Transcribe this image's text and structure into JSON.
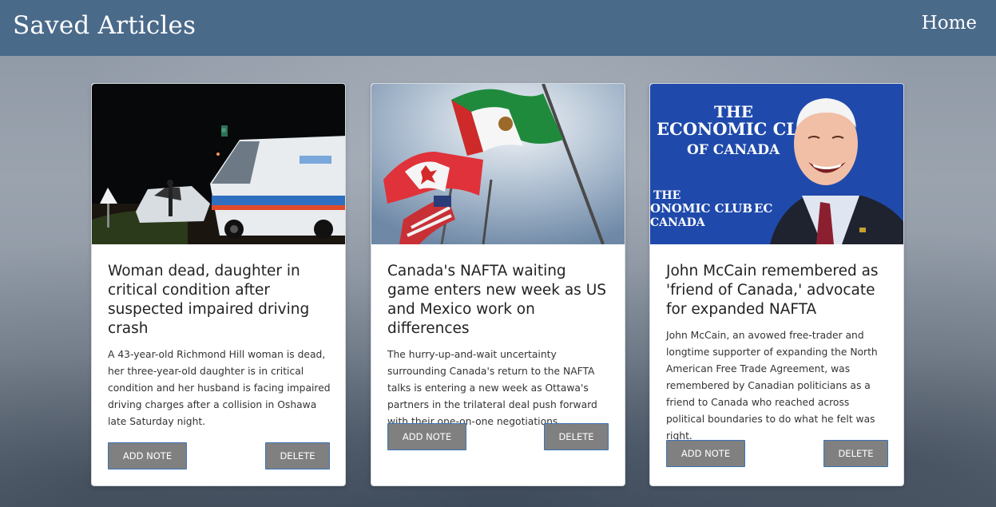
{
  "navbar": {
    "brand": "Saved Articles",
    "home_label": "Home"
  },
  "articles": [
    {
      "image_alt": "Night scene of a crashed white van after collision",
      "title": "Woman dead, daughter in critical condition after suspected impaired driving crash",
      "summary": "A 43-year-old Richmond Hill woman is dead, her three-year-old daughter is in critical condition and her husband is facing impaired driving charges after a collision in Oshawa late Saturday night.",
      "add_note_label": "ADD NOTE",
      "delete_label": "DELETE"
    },
    {
      "image_alt": "Canadian, Mexican and US flags on poles",
      "title": "Canada's NAFTA waiting game enters new week as US and Mexico work on differences",
      "summary": "The hurry-up-and-wait uncertainty surrounding Canada's return to the NAFTA talks is entering a new week as Ottawa's partners in the trilateral deal push forward with their one-on-one negotiations.",
      "add_note_label": "ADD NOTE",
      "delete_label": "DELETE"
    },
    {
      "image_alt": "John McCain laughing in front of The Economic Club of Canada backdrop",
      "title": "John McCain remembered as 'friend of Canada,' advocate for expanded NAFTA",
      "summary": "John McCain, an avowed free-trader and longtime supporter of expanding the North American Free Trade Agreement, was remembered by Canadian politicians as a friend to Canada who reached across political boundaries to do what he felt was right.",
      "add_note_label": "ADD NOTE",
      "delete_label": "DELETE",
      "image_text": {
        "line1": "THE",
        "line2": "ECONOMIC CLUB",
        "line3": "OF CANADA",
        "line4": "THE",
        "line5": "ONOMIC CLUB",
        "line6": "CANADA",
        "line7": "EC"
      }
    }
  ],
  "colors": {
    "navbar": "#4a6a8a",
    "button_bg": "#808080",
    "button_border": "#3b73b7"
  }
}
